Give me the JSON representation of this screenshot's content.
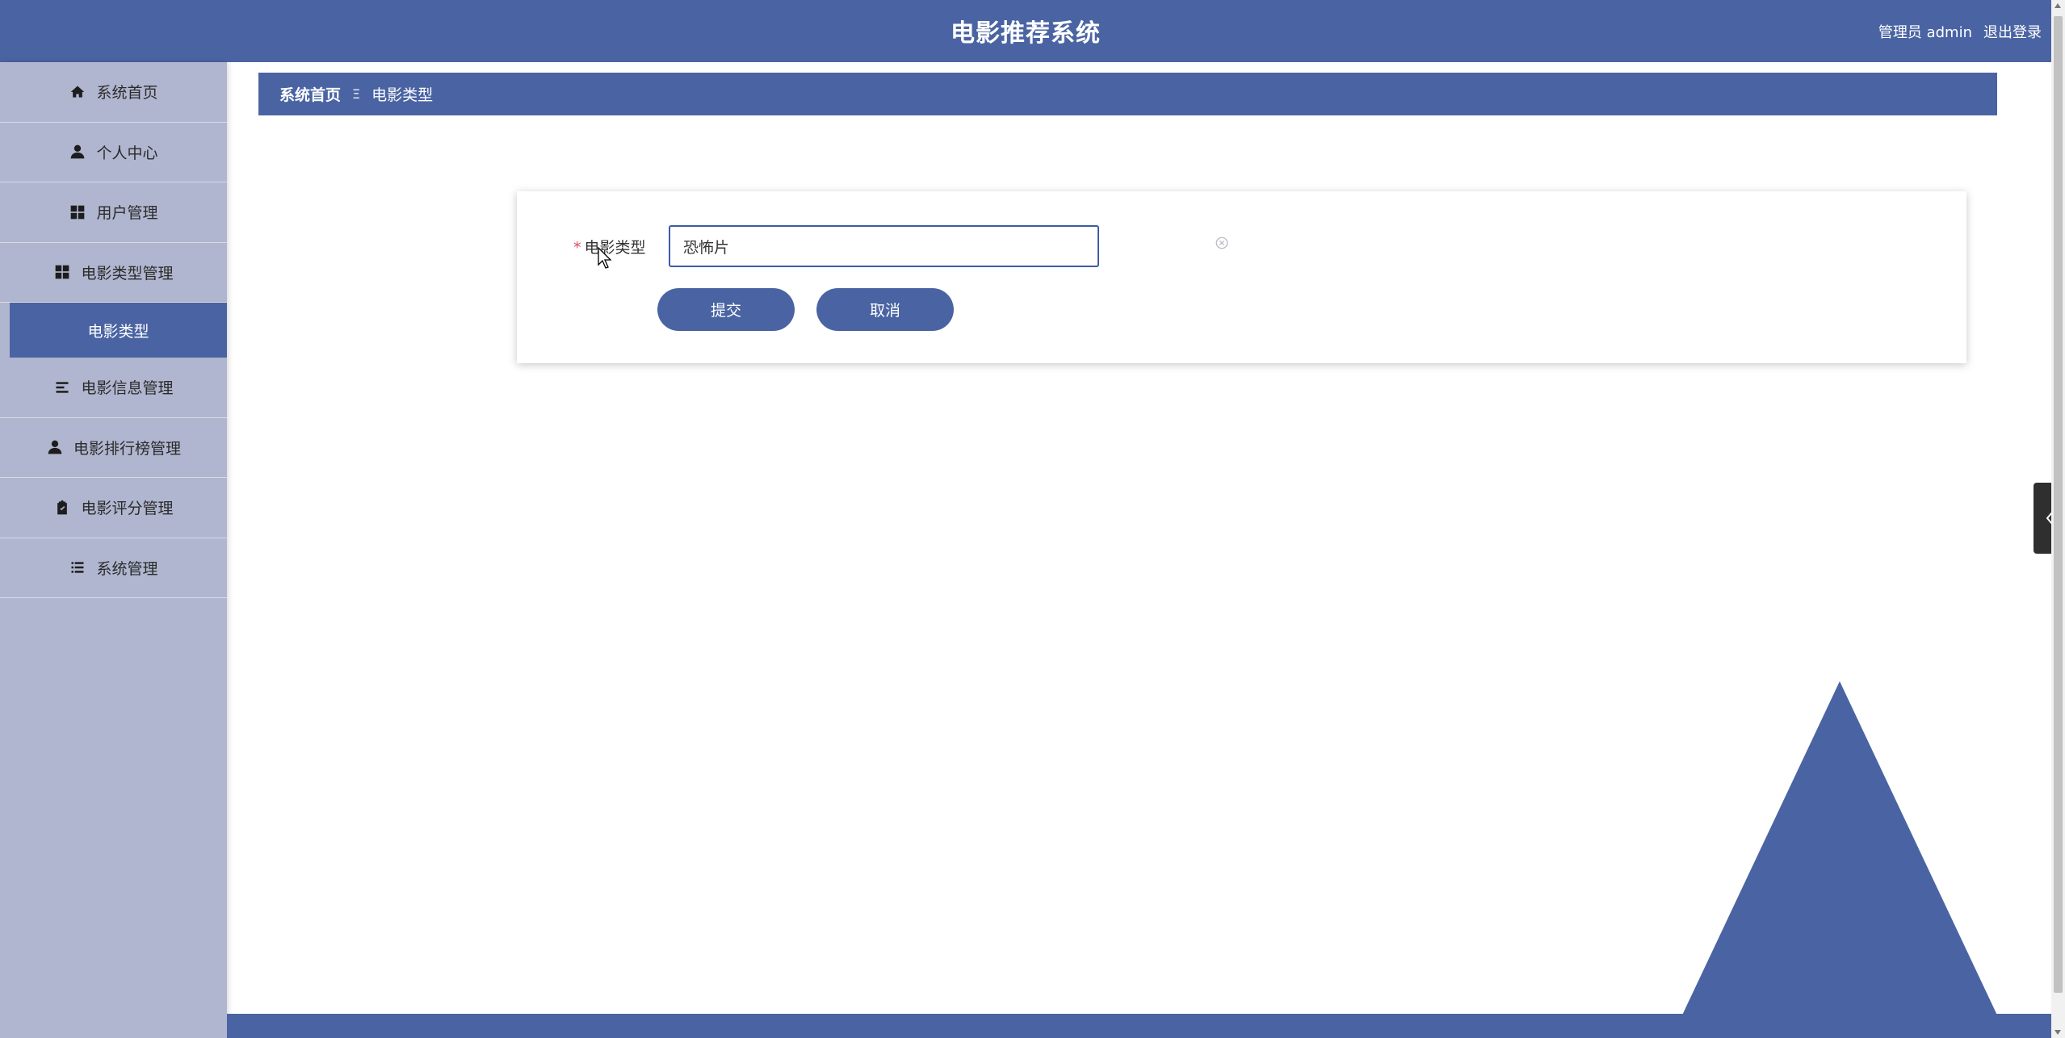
{
  "header": {
    "title": "电影推荐系统",
    "user_label": "管理员 admin",
    "logout_label": "退出登录"
  },
  "sidebar": {
    "items": [
      {
        "label": "系统首页",
        "icon": "home-icon"
      },
      {
        "label": "个人中心",
        "icon": "user-icon"
      },
      {
        "label": "用户管理",
        "icon": "grid-icon"
      },
      {
        "label": "电影类型管理",
        "icon": "grid-icon"
      },
      {
        "label": "电影类型",
        "icon": ""
      },
      {
        "label": "电影信息管理",
        "icon": "list-icon"
      },
      {
        "label": "电影排行榜管理",
        "icon": "user-icon"
      },
      {
        "label": "电影评分管理",
        "icon": "clipboard-icon"
      },
      {
        "label": "系统管理",
        "icon": "list-icon"
      }
    ]
  },
  "breadcrumb": {
    "home": "系统首页",
    "separator": "Ξ",
    "current": "电影类型"
  },
  "form": {
    "required_mark": "*",
    "label": "电影类型",
    "value": "恐怖片",
    "submit_label": "提交",
    "cancel_label": "取消"
  },
  "colors": {
    "primary": "#4a64a3",
    "sidebar": "#b0b6cf",
    "required": "#e0495c"
  }
}
